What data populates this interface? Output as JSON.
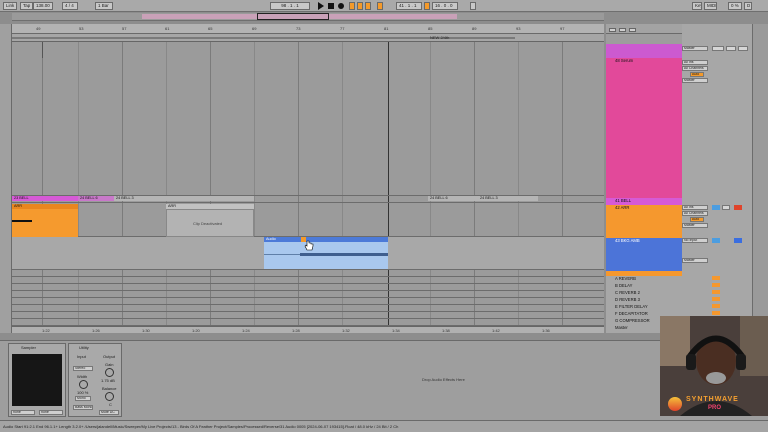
{
  "transport": {
    "link": "Link",
    "tap": "Tap",
    "tempo": "138.00",
    "time_sig": "4 / 4",
    "quantize": "1 Bar",
    "position": "98 . 1 . 1",
    "loop_start": "41 . 1 . 1",
    "loop_length": "16 . 0 . 0",
    "key": "Key",
    "midi": "MIDI",
    "cpu": "0 %",
    "d": "D"
  },
  "ruler": {
    "ticks": [
      "49",
      "53",
      "57",
      "61",
      "65",
      "69",
      "73",
      "77",
      "81",
      "85",
      "89",
      "93",
      "97",
      "101"
    ],
    "time_ticks": [
      "1:20",
      "1:24",
      "1:28",
      "1:32",
      "1:36",
      "1:40",
      "1:44"
    ],
    "time_marks": [
      "1:22",
      "1:26",
      "1:30",
      "1:34",
      "1:38",
      "1:42"
    ]
  },
  "locator": "NEW 2/4th",
  "clips": {
    "bell_1": "23 BELL",
    "bell_2": "24 BELL 6",
    "bell_3": "24 BELL 3",
    "bell_4": "24 BELL 6",
    "bell_5": "24 BELL 3",
    "arr_1": "ARR",
    "arr_2": "ARR",
    "deactivated": "Clip Deactivated",
    "audio": "Audio"
  },
  "tracks": [
    {
      "name": "48 Serum",
      "color": "#e2499a"
    },
    {
      "name": "41 BELL",
      "color": "#d65ad6"
    },
    {
      "name": "42 ARR",
      "color": "#f5982e"
    },
    {
      "name": "43 BKG AMB",
      "color": "#4c74d8"
    }
  ],
  "returns": [
    "A REVERB",
    "B DELAY",
    "C REVERB 2",
    "D REVERB 3",
    "E FILTER DELAY",
    "F DECAPITATOR",
    "G COMPRESSOR"
  ],
  "master": "Master",
  "mixer": {
    "input_all": "All Ins",
    "channel": "All Channels",
    "auto": "Auto",
    "master": "Master",
    "no_input": "No Input",
    "monitor_in": "In",
    "monitor_off": "Off"
  },
  "devices": {
    "sampler_title": "Sampler",
    "utility_title": "Utility",
    "input_label": "Input",
    "output_label": "Output",
    "stereo": "Stereo",
    "gain_label": "Gain",
    "gain_value": "1.75 dB",
    "width_label": "Width",
    "width_value": "100 %",
    "mono_label": "Mono",
    "bass_mono_label": "Bass Mono",
    "balance_label": "Balance",
    "balance_value": "C",
    "mute_dc": "Mute DC",
    "drop_text": "Drop Audio Effects Here",
    "none_1": "none",
    "none_2": "none"
  },
  "status_bar": "Audio Start 91:2.1 End 96.1.1+ Length 3.2.0+ /Users/jalandell/Music/Sweeper/My Live Projects/13 - Birds Of A Feather Project/Samples/Processed/Reverse/31 Audio 0005 [2024-06-07 193415].Float / 48.0 kHz / 24 Bit / 2 Ch",
  "logo": {
    "line1": "SYNTHWAVE",
    "line2": "PRO"
  }
}
